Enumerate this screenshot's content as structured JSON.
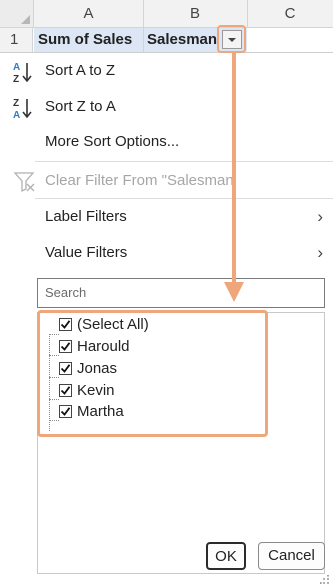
{
  "sheet": {
    "columns": [
      "A",
      "B",
      "C"
    ],
    "row_number": "1",
    "cell_a1": "Sum of Sales",
    "cell_b1": "Salesman"
  },
  "menu": {
    "sort_az": "Sort A to Z",
    "sort_za": "Sort Z to A",
    "more_sort": "More Sort Options...",
    "clear_filter": "Clear Filter From \"Salesman",
    "label_filters": "Label Filters",
    "value_filters": "Value Filters"
  },
  "search": {
    "placeholder": "Search"
  },
  "filter_list": [
    {
      "label": "(Select All)",
      "checked": true
    },
    {
      "label": "Harould",
      "checked": true
    },
    {
      "label": "Jonas",
      "checked": true
    },
    {
      "label": "Kevin",
      "checked": true
    },
    {
      "label": "Martha",
      "checked": true
    }
  ],
  "buttons": {
    "ok": "OK",
    "cancel": "Cancel"
  },
  "icons": {
    "sort_az": "sort-a-to-z-icon",
    "sort_za": "sort-z-to-a-icon",
    "clear_filter": "clear-filter-icon",
    "submenu": "chevron-right-icon",
    "dropdown": "dropdown-arrow-icon"
  },
  "colors": {
    "annotation": "#eea67a",
    "header_cell_bg": "#dde6f5",
    "sort_icon_blue": "#2f7bc4"
  }
}
